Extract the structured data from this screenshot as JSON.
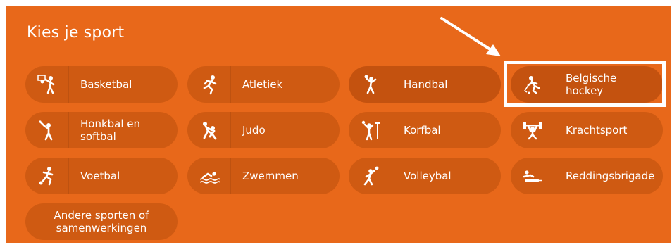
{
  "header": {
    "title": "Kies je sport"
  },
  "sports": [
    {
      "label": "Basketbal",
      "icon": "basketball-icon"
    },
    {
      "label": "Atletiek",
      "icon": "athletics-icon"
    },
    {
      "label": "Handbal",
      "icon": "handball-icon"
    },
    {
      "label": "Belgische hockey",
      "icon": "hockey-icon"
    },
    {
      "label": "Honkbal en softbal",
      "icon": "baseball-icon"
    },
    {
      "label": "Judo",
      "icon": "judo-icon"
    },
    {
      "label": "Korfbal",
      "icon": "korfball-icon"
    },
    {
      "label": "Krachtsport",
      "icon": "weightlifting-icon"
    },
    {
      "label": "Voetbal",
      "icon": "football-icon"
    },
    {
      "label": "Zwemmen",
      "icon": "swimming-icon"
    },
    {
      "label": "Volleybal",
      "icon": "volleyball-icon"
    },
    {
      "label": "Reddingsbrigade",
      "icon": "lifesaving-icon"
    },
    {
      "label": "Andere sporten of samenwerkingen",
      "icon": ""
    }
  ],
  "colors": {
    "panel": "#e8681a",
    "button": "#cf5a12",
    "highlight": "#ffffff"
  }
}
